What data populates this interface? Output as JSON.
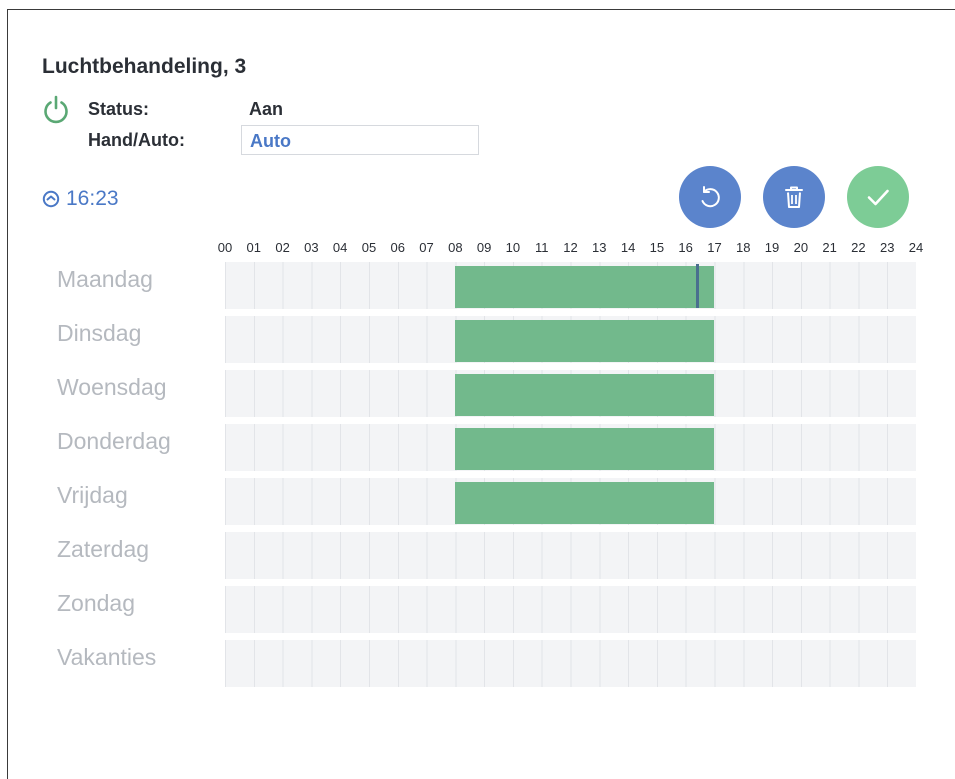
{
  "device": {
    "title": "Luchtbehandeling, 3",
    "status_label": "Status:",
    "status_value": "Aan",
    "mode_label": "Hand/Auto:",
    "mode_value": "Auto"
  },
  "clock": {
    "time": "16:23"
  },
  "actions": [
    {
      "name": "reset-button",
      "icon": "undo-icon",
      "color": "#5b84cc"
    },
    {
      "name": "delete-button",
      "icon": "trash-icon",
      "color": "#5b84cc"
    },
    {
      "name": "confirm-button",
      "icon": "check-icon",
      "color": "#7dcc96"
    }
  ],
  "colors": {
    "power": "#5aa874",
    "accent": "#4a78c6",
    "block": "#72b98c",
    "marker": "#4a6f8f"
  },
  "hours": [
    "00",
    "01",
    "02",
    "03",
    "04",
    "05",
    "06",
    "07",
    "08",
    "09",
    "10",
    "11",
    "12",
    "13",
    "14",
    "15",
    "16",
    "17",
    "18",
    "19",
    "20",
    "21",
    "22",
    "23",
    "24"
  ],
  "days": [
    "Maandag",
    "Dinsdag",
    "Woensdag",
    "Donderdag",
    "Vrijdag",
    "Zaterdag",
    "Zondag",
    "Vakanties"
  ],
  "schedule": [
    {
      "day": "Maandag",
      "start": 8,
      "end": 17
    },
    {
      "day": "Dinsdag",
      "start": 8,
      "end": 17
    },
    {
      "day": "Woensdag",
      "start": 8,
      "end": 17
    },
    {
      "day": "Donderdag",
      "start": 8,
      "end": 17
    },
    {
      "day": "Vrijdag",
      "start": 8,
      "end": 17
    }
  ],
  "current_time_hours": 16.38
}
